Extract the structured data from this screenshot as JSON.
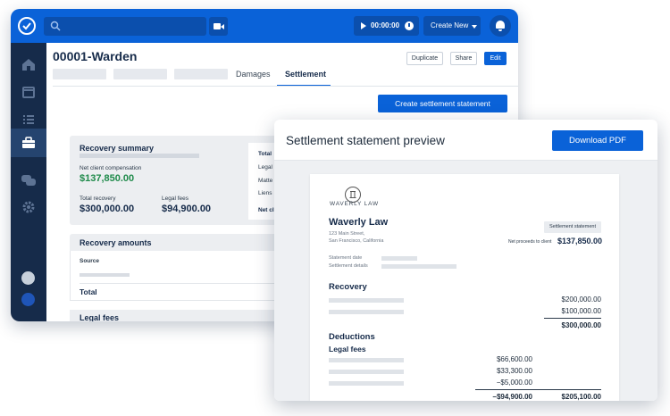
{
  "app": {
    "timer": "00:00:00",
    "create_new": "Create New",
    "page_title": "00001-Warden",
    "tabs": [
      "Damages",
      "Settlement"
    ],
    "buttons": {
      "duplicate": "Duplicate",
      "share": "Share",
      "edit": "Edit"
    },
    "create_statement": "Create settlement statement",
    "recovery_summary": {
      "title": "Recovery summary",
      "net_label": "Net client compensation",
      "net_value": "$137,850.00",
      "total_recovery_label": "Total recovery",
      "total_recovery_value": "$300,000.00",
      "legal_fees_label": "Legal fees",
      "legal_fees_value": "$94,900.00",
      "side_items": [
        "Total",
        "Legal",
        "Matte",
        "Liens",
        "Net cl"
      ]
    },
    "recovery_amounts": {
      "title": "Recovery amounts",
      "source": "Source",
      "total": "Total"
    },
    "legal_fees_section": "Legal fees",
    "colors": {
      "brand_blue": "#0a62d8",
      "sidebar": "#162b4a",
      "green": "#1e8a4a"
    }
  },
  "modal": {
    "title": "Settlement statement preview",
    "download": "Download PDF",
    "doc": {
      "logo_text": "WAVERLY LAW",
      "firm": "Waverly Law",
      "address1": "123 Main Street,",
      "address2": "San Francisco, California",
      "badge": "Settlement statement",
      "net_label": "Net proceeds to client",
      "net_value": "$137,850.00",
      "statement_date": "Statement date",
      "settlement_details": "Settlement details",
      "recovery_title": "Recovery",
      "recovery_values": [
        "$200,000.00",
        "$100,000.00"
      ],
      "recovery_total": "$300,000.00",
      "deductions_title": "Deductions",
      "legal_fees_title": "Legal fees",
      "fee_values": [
        "$66,600.00",
        "$33,300.00",
        "−$5,000.00"
      ],
      "fee_total": "−$94,900.00",
      "grand_total": "$205,100.00"
    }
  }
}
